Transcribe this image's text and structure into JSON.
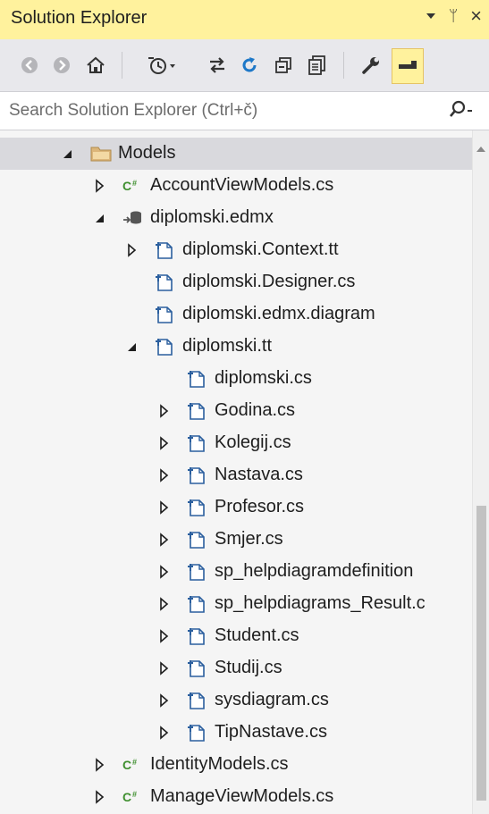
{
  "window": {
    "title": "Solution Explorer",
    "pin_glyph": "ᛘ",
    "close_glyph": "×"
  },
  "toolbar": {
    "items": [
      {
        "name": "back-icon"
      },
      {
        "name": "forward-icon"
      },
      {
        "name": "home-icon"
      },
      {
        "name": "pending-changes-icon"
      },
      {
        "name": "sync-icon"
      },
      {
        "name": "refresh-icon"
      },
      {
        "name": "collapse-all-icon"
      },
      {
        "name": "show-all-files-icon"
      },
      {
        "name": "properties-icon"
      },
      {
        "name": "preview-icon",
        "active": true
      }
    ],
    "accent": "#fff29d"
  },
  "search": {
    "placeholder": "Search Solution Explorer (Ctrl+č)"
  },
  "tree": [
    {
      "label": "Models",
      "level": 0,
      "expander": "expanded",
      "icon": "folder",
      "selected": true
    },
    {
      "label": "AccountViewModels.cs",
      "level": 1,
      "expander": "collapsed",
      "icon": "csharp"
    },
    {
      "label": "diplomski.edmx",
      "level": 1,
      "expander": "expanded",
      "icon": "edmx"
    },
    {
      "label": "diplomski.Context.tt",
      "level": 2,
      "expander": "collapsed",
      "icon": "tt"
    },
    {
      "label": "diplomski.Designer.cs",
      "level": 2,
      "expander": "none",
      "icon": "tt"
    },
    {
      "label": "diplomski.edmx.diagram",
      "level": 2,
      "expander": "none",
      "icon": "tt"
    },
    {
      "label": "diplomski.tt",
      "level": 2,
      "expander": "expanded",
      "icon": "tt"
    },
    {
      "label": "diplomski.cs",
      "level": 3,
      "expander": "none",
      "icon": "tt"
    },
    {
      "label": "Godina.cs",
      "level": 3,
      "expander": "collapsed",
      "icon": "tt"
    },
    {
      "label": "Kolegij.cs",
      "level": 3,
      "expander": "collapsed",
      "icon": "tt"
    },
    {
      "label": "Nastava.cs",
      "level": 3,
      "expander": "collapsed",
      "icon": "tt"
    },
    {
      "label": "Profesor.cs",
      "level": 3,
      "expander": "collapsed",
      "icon": "tt"
    },
    {
      "label": "Smjer.cs",
      "level": 3,
      "expander": "collapsed",
      "icon": "tt"
    },
    {
      "label": "sp_helpdiagramdefinition",
      "level": 3,
      "expander": "collapsed",
      "icon": "tt"
    },
    {
      "label": "sp_helpdiagrams_Result.c",
      "level": 3,
      "expander": "collapsed",
      "icon": "tt"
    },
    {
      "label": "Student.cs",
      "level": 3,
      "expander": "collapsed",
      "icon": "tt"
    },
    {
      "label": "Studij.cs",
      "level": 3,
      "expander": "collapsed",
      "icon": "tt"
    },
    {
      "label": "sysdiagram.cs",
      "level": 3,
      "expander": "collapsed",
      "icon": "tt"
    },
    {
      "label": "TipNastave.cs",
      "level": 3,
      "expander": "collapsed",
      "icon": "tt"
    },
    {
      "label": "IdentityModels.cs",
      "level": 1,
      "expander": "collapsed",
      "icon": "csharp"
    },
    {
      "label": "ManageViewModels.cs",
      "level": 1,
      "expander": "collapsed",
      "icon": "csharp"
    }
  ],
  "scrollbar": {
    "position_fraction": 0.55
  }
}
